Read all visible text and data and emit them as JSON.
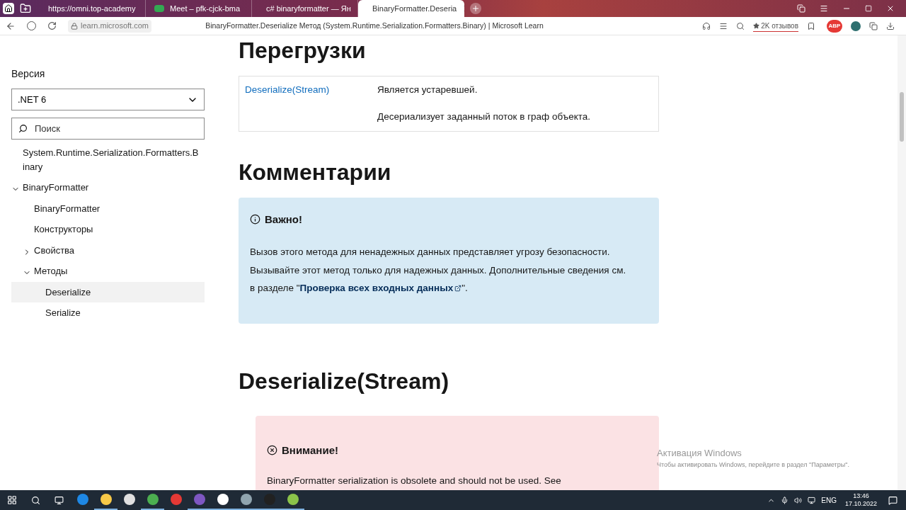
{
  "browser": {
    "tabs": [
      {
        "title": "https://omni.top-academy",
        "kind": "blank",
        "selected": false
      },
      {
        "title": "Meet – pfk-cjck-bma",
        "kind": "meet",
        "selected": false
      },
      {
        "title": "c# binaryformatter — Ян",
        "kind": "yandex",
        "selected": false
      },
      {
        "title": "BinaryFormatter.Deseria",
        "kind": "microsoft",
        "selected": true
      }
    ],
    "url": "learn.microsoft.com",
    "page_title": "BinaryFormatter.Deserialize Метод (System.Runtime.Serialization.Formatters.Binary) | Microsoft Learn",
    "reviews": "2K отзывов",
    "abp": "ABP"
  },
  "sidebar": {
    "version_label": "Версия",
    "version": ".NET 6",
    "search_placeholder": "Поиск",
    "tree": [
      {
        "label": "System.Runtime.Serialization.Formatters.Binary",
        "selected": false
      },
      {
        "label": "BinaryFormatter",
        "selected": false,
        "expanded": true,
        "children": [
          {
            "label": "BinaryFormatter",
            "selected": false
          },
          {
            "label": "Конструкторы",
            "selected": false
          },
          {
            "label": "Свойства",
            "selected": false,
            "expanded": false
          },
          {
            "label": "Методы",
            "selected": false,
            "expanded": true,
            "children": [
              {
                "label": "Deserialize",
                "selected": true
              },
              {
                "label": "Serialize",
                "selected": false
              }
            ]
          }
        ]
      }
    ]
  },
  "content": {
    "overloads_heading": "Перегрузки",
    "overloads": [
      {
        "name": "Deserialize(Stream)",
        "descriptions": [
          "Является устаревшей.",
          "Десериализует заданный поток в граф объекта."
        ]
      }
    ],
    "remarks_heading": "Комментарии",
    "important": {
      "title": "Важно!",
      "text": "Вызов этого метода для ненадежных данных представляет угрозу безопасности. Вызывайте этот метод только для надежных данных. Дополнительные сведения см. в разделе \"",
      "link": "Проверка всех входных данных",
      "after": "\"."
    },
    "method_heading": "Deserialize(Stream)",
    "caution": {
      "title": "Внимание!",
      "text": "BinaryFormatter serialization is obsolete and should not be used. See"
    }
  },
  "activation": {
    "title": "Активация Windows",
    "text": "Чтобы активировать Windows, перейдите в раздел \"Параметры\"."
  },
  "taskbar": {
    "apps": [
      {
        "kind": "edge",
        "active": false
      },
      {
        "kind": "folder",
        "active": true
      },
      {
        "kind": "store",
        "active": false
      },
      {
        "kind": "chrome",
        "active": true
      },
      {
        "kind": "yandex",
        "active": false
      },
      {
        "kind": "vs",
        "active": true
      },
      {
        "kind": "ybrowser",
        "active": true
      },
      {
        "kind": "paint",
        "active": true
      },
      {
        "kind": "obs",
        "active": true
      },
      {
        "kind": "notepad",
        "active": true
      }
    ],
    "lang": "ENG",
    "time": "13:46",
    "date": "17.10.2022"
  }
}
